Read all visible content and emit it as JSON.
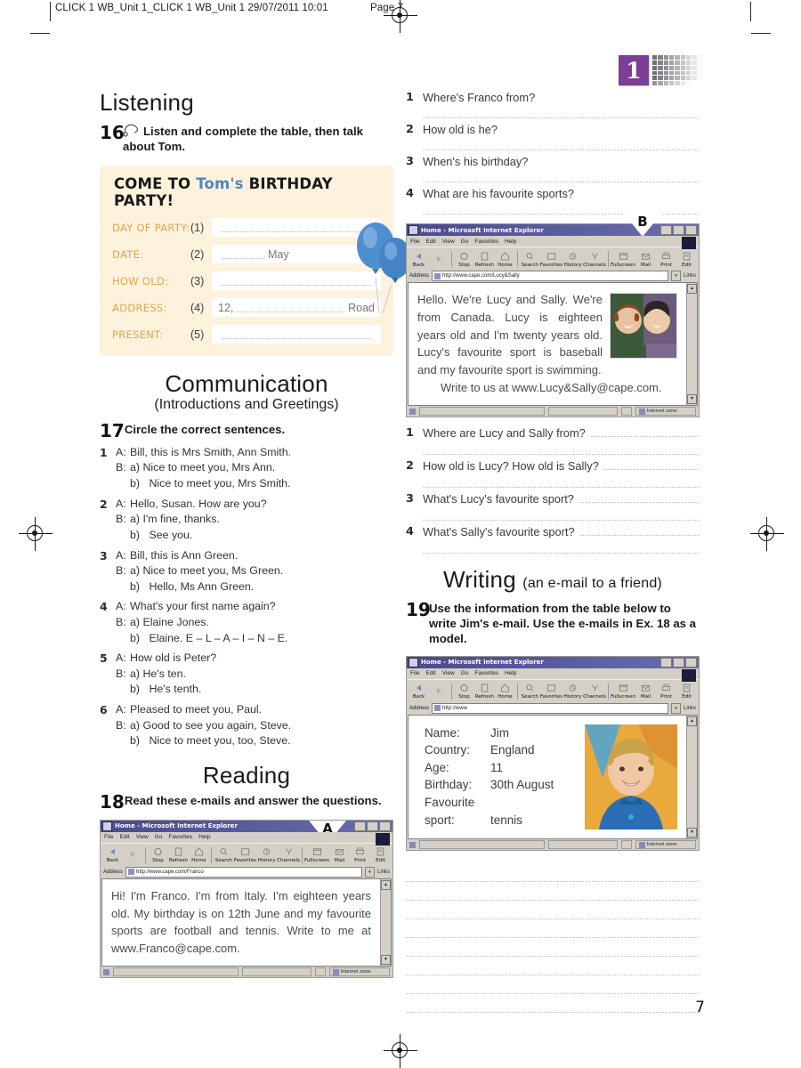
{
  "print_header": {
    "file_info": "CLICK 1 WB_Unit 1_CLICK 1 WB_Unit 1  29/07/2011  10:01",
    "page_label": "Page 7"
  },
  "unit_badge": {
    "number": "1"
  },
  "page_number": "7",
  "left_column": {
    "listening": {
      "heading": "Listening",
      "exercise_number": "16",
      "instruction": "Listen and complete the table, then talk about Tom.",
      "icon": "headphones-icon"
    },
    "invitation_card": {
      "title_pre": "COME TO ",
      "title_name": "Tom's",
      "title_post": " BIRTHDAY PARTY!",
      "name_color": "#4a87c7",
      "label_color": "#e0a64a",
      "background": "#fdf3dd",
      "rows": [
        {
          "label": "DAY OF PARTY:",
          "number": "(1)",
          "prefix": "",
          "suffix": ""
        },
        {
          "label": "DATE:",
          "number": "(2)",
          "prefix": "",
          "suffix": "May"
        },
        {
          "label": "HOW OLD:",
          "number": "(3)",
          "prefix": "",
          "suffix": ""
        },
        {
          "label": "ADDRESS:",
          "number": "(4)",
          "prefix": "12,",
          "suffix": "Road"
        },
        {
          "label": "PRESENT:",
          "number": "(5)",
          "prefix": "",
          "suffix": ""
        }
      ],
      "decoration": "blue-balloons"
    },
    "communication": {
      "heading": "Communication",
      "subheading": "(Introductions and Greetings)",
      "exercise_number": "17",
      "instruction": "Circle the correct sentences.",
      "items": [
        {
          "num": "1",
          "a": "Bill, this is Mrs Smith, Ann Smith.",
          "options": [
            "Nice to meet you, Mrs Ann.",
            "Nice to meet you, Mrs Smith."
          ]
        },
        {
          "num": "2",
          "a": "Hello, Susan. How are you?",
          "options": [
            "I'm fine, thanks.",
            "See you."
          ]
        },
        {
          "num": "3",
          "a": "Bill, this is Ann Green.",
          "options": [
            "Nice to meet you, Ms Green.",
            "Hello, Ms Ann Green."
          ]
        },
        {
          "num": "4",
          "a": "What's your first name again?",
          "options": [
            "Elaine Jones.",
            "Elaine. E – L – A – I – N – E."
          ]
        },
        {
          "num": "5",
          "a": "How old is Peter?",
          "options": [
            "He's ten.",
            "He's tenth."
          ]
        },
        {
          "num": "6",
          "a": "Pleased to meet you, Paul.",
          "options": [
            "Good to see you again, Steve.",
            "Nice to meet you, too, Steve."
          ]
        }
      ],
      "speaker_a": "A:",
      "speaker_b": "B:",
      "opt_a": "a)",
      "opt_b": "b)"
    },
    "reading": {
      "heading": "Reading",
      "exercise_number": "18",
      "instruction": "Read these e-mails and answer the questions."
    },
    "browser_a": {
      "marker": "A",
      "title": "Home - Microsoft Internet Explorer",
      "address": "http://www.cape.com/Franco",
      "body_text": "Hi! I'm Franco. I'm from Italy. I'm eighteen years old. My birthday is on 12th June and my favourite sports are football and tennis. Write to me at www.Franco@cape.com.",
      "status": "Internet zone"
    }
  },
  "right_column": {
    "franco_questions": [
      {
        "num": "1",
        "text": "Where's Franco from?"
      },
      {
        "num": "2",
        "text": "How old is he?"
      },
      {
        "num": "3",
        "text": "When's his birthday?"
      },
      {
        "num": "4",
        "text": "What are his favourite sports?"
      }
    ],
    "browser_b": {
      "marker": "B",
      "title": "Home - Microsoft Internet Explorer",
      "address": "http://www.cape.com/Lucy&Sally",
      "body_text": "Hello. We're Lucy and Sally. We're from Canada. Lucy is eighteen years old and I'm twenty years old. Lucy's favourite sport is baseball and my favourite sport is swimming.",
      "body_text2": "Write to us at www.Lucy&Sally@cape.com.",
      "photo": "two-girls-photo",
      "status": "Internet zone"
    },
    "lucy_sally_questions": [
      {
        "num": "1",
        "text": "Where are Lucy and Sally from?"
      },
      {
        "num": "2",
        "text": "How old is Lucy? How old is Sally?"
      },
      {
        "num": "3",
        "text": "What's Lucy's favourite sport?"
      },
      {
        "num": "4",
        "text": "What's Sally's favourite sport?"
      }
    ],
    "writing": {
      "heading": "Writing",
      "subheading": "(an e-mail to a friend)",
      "exercise_number": "19",
      "instruction": "Use the information from the table below to write Jim's e-mail. Use the e-mails in Ex. 18 as a model."
    },
    "browser_c": {
      "title": "Home - Microsoft Internet Explorer",
      "address": "http://www",
      "photo": "boy-photo",
      "status": "Internet zone",
      "profile": [
        {
          "key": "Name:",
          "value": "Jim"
        },
        {
          "key": "Country:",
          "value": "England"
        },
        {
          "key": "Age:",
          "value": "11"
        },
        {
          "key": "Birthday:",
          "value": "30th August"
        },
        {
          "key": "Favourite",
          "value": ""
        },
        {
          "key": "sport:",
          "value": "tennis"
        }
      ]
    },
    "writing_lines_count": 8
  },
  "browser_chrome": {
    "menus": [
      "File",
      "Edit",
      "View",
      "Go",
      "Favorites",
      "Help"
    ],
    "toolbar": [
      "Back",
      "Forward",
      "Stop",
      "Refresh",
      "Home",
      "Search",
      "Favorites",
      "History",
      "Channels",
      "Fullscreen",
      "Mail",
      "Print",
      "Edit"
    ],
    "address_label": "Address",
    "links_label": "Links"
  }
}
